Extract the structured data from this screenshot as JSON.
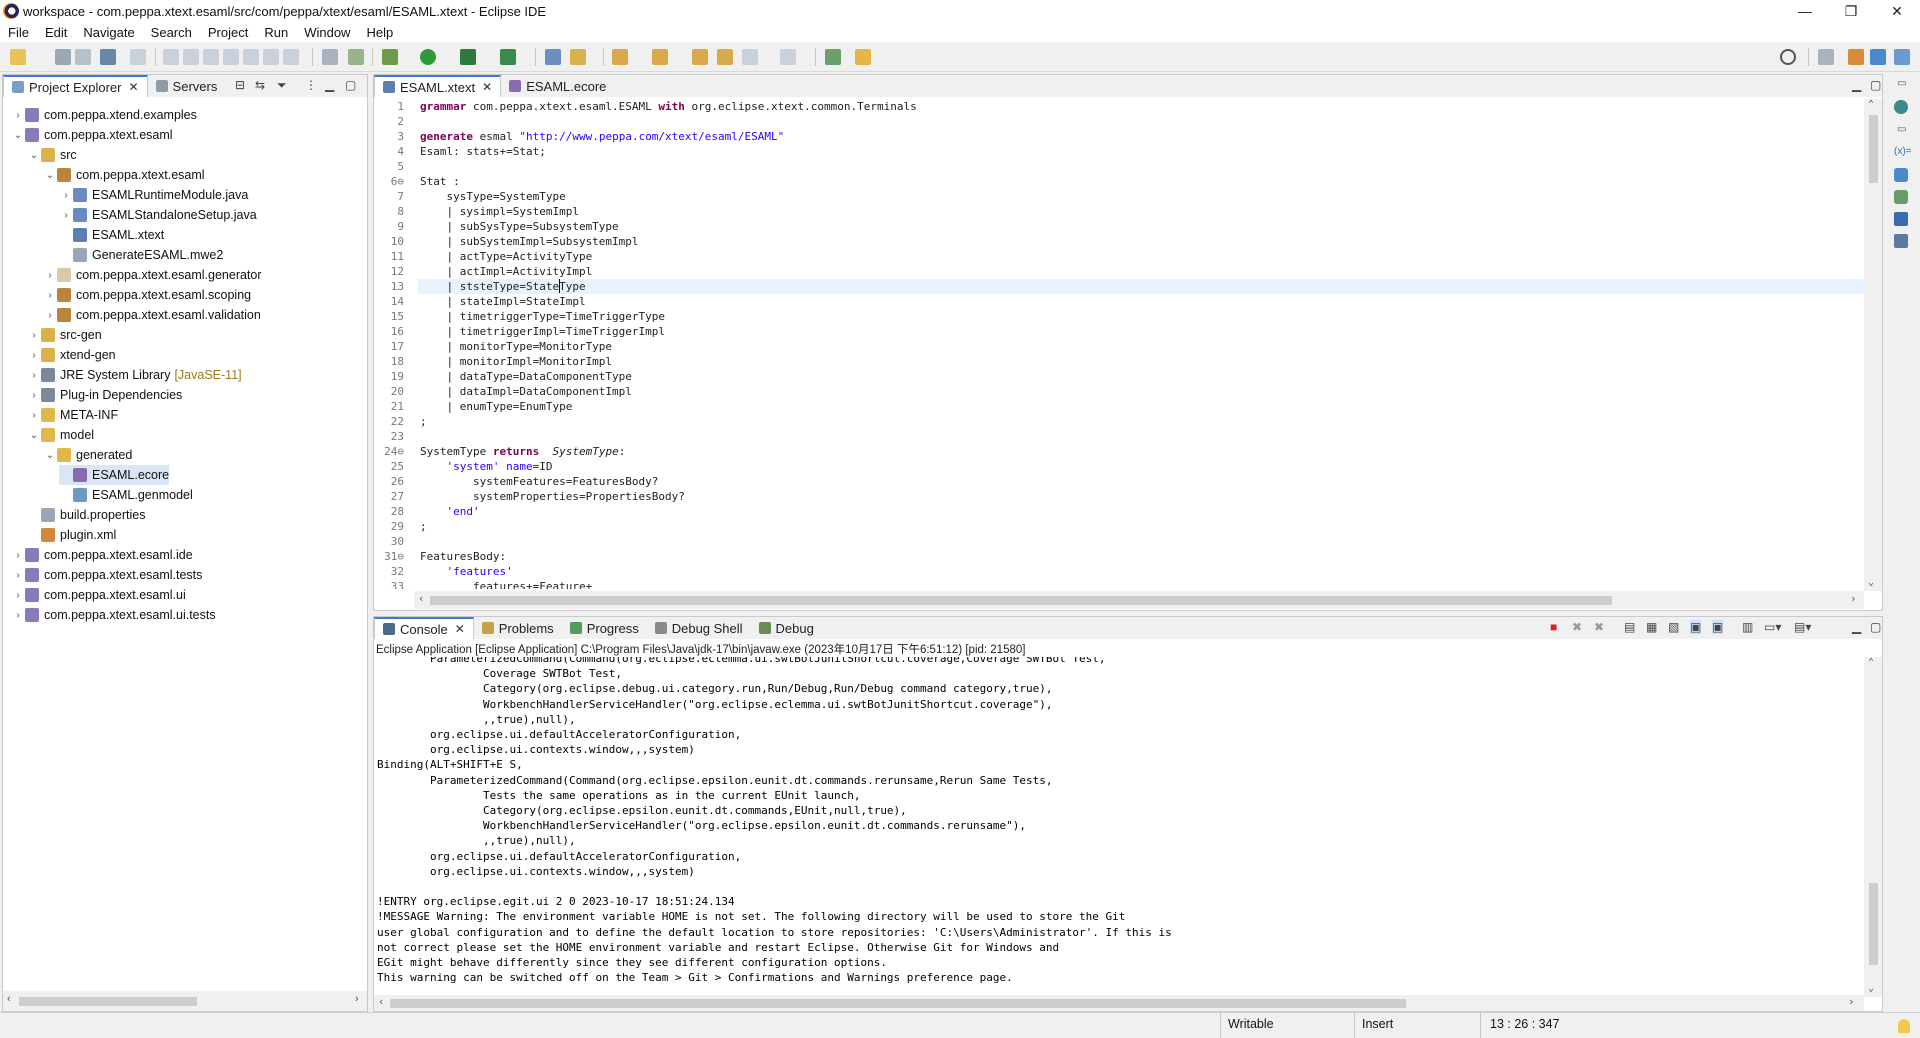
{
  "window": {
    "title": "workspace - com.peppa.xtext.esaml/src/com/peppa/xtext/esaml/ESAML.xtext - Eclipse IDE",
    "minimize": "—",
    "maximize": "❐",
    "close": "✕"
  },
  "menu": [
    "File",
    "Edit",
    "Navigate",
    "Search",
    "Project",
    "Run",
    "Window",
    "Help"
  ],
  "left_panel": {
    "tabs": [
      {
        "label": "Project Explorer",
        "close": "✕"
      },
      {
        "label": "Servers"
      }
    ],
    "tree": [
      {
        "label": "com.peppa.xtend.examples",
        "arrow": "›",
        "icon": "project-icon"
      },
      {
        "label": "com.peppa.xtext.esaml",
        "arrow": "⌄",
        "icon": "project-icon"
      },
      {
        "label": "src",
        "arrow": "⌄",
        "icon": "source-folder-icon"
      },
      {
        "label": "com.peppa.xtext.esaml",
        "arrow": "⌄",
        "icon": "package-icon"
      },
      {
        "label": "ESAMLRuntimeModule.java",
        "arrow": "›",
        "icon": "java-file-icon"
      },
      {
        "label": "ESAMLStandaloneSetup.java",
        "arrow": "›",
        "icon": "java-file-icon"
      },
      {
        "label": "ESAML.xtext",
        "arrow": "",
        "icon": "xtext-file-icon"
      },
      {
        "label": "GenerateESAML.mwe2",
        "arrow": "",
        "icon": "mwe2-file-icon"
      },
      {
        "label": "com.peppa.xtext.esaml.generator",
        "arrow": "›",
        "icon": "package-empty-icon"
      },
      {
        "label": "com.peppa.xtext.esaml.scoping",
        "arrow": "›",
        "icon": "package-icon"
      },
      {
        "label": "com.peppa.xtext.esaml.validation",
        "arrow": "›",
        "icon": "package-icon"
      },
      {
        "label": "src-gen",
        "arrow": "›",
        "icon": "source-folder-icon"
      },
      {
        "label": "xtend-gen",
        "arrow": "›",
        "icon": "source-folder-icon"
      },
      {
        "label": "JRE System Library",
        "decoration": "[JavaSE-11]",
        "arrow": "›",
        "icon": "library-icon"
      },
      {
        "label": "Plug-in Dependencies",
        "arrow": "›",
        "icon": "library-icon"
      },
      {
        "label": "META-INF",
        "arrow": "›",
        "icon": "folder-icon"
      },
      {
        "label": "model",
        "arrow": "⌄",
        "icon": "folder-icon"
      },
      {
        "label": "generated",
        "arrow": "⌄",
        "icon": "folder-icon"
      },
      {
        "label": "ESAML.ecore",
        "arrow": "",
        "icon": "ecore-file-icon"
      },
      {
        "label": "ESAML.genmodel",
        "arrow": "",
        "icon": "genmodel-file-icon"
      },
      {
        "label": "build.properties",
        "arrow": "",
        "icon": "properties-file-icon"
      },
      {
        "label": "plugin.xml",
        "arrow": "",
        "icon": "xml-file-icon"
      },
      {
        "label": "com.peppa.xtext.esaml.ide",
        "arrow": "›",
        "icon": "project-icon"
      },
      {
        "label": "com.peppa.xtext.esaml.tests",
        "arrow": "›",
        "icon": "project-icon"
      },
      {
        "label": "com.peppa.xtext.esaml.ui",
        "arrow": "›",
        "icon": "project-icon"
      },
      {
        "label": "com.peppa.xtext.esaml.ui.tests",
        "arrow": "›",
        "icon": "project-icon"
      }
    ]
  },
  "editor": {
    "tabs": [
      {
        "label": "ESAML.xtext",
        "close": "✕"
      },
      {
        "label": "ESAML.ecore"
      }
    ],
    "lines": [
      {
        "n": "1",
        "t": [
          [
            "kw",
            "grammar"
          ],
          [
            "",
            "com.peppa.xtext.esaml.ESAML "
          ],
          [
            "kw",
            "with"
          ],
          [
            "",
            "org.eclipse.xtext.common.Terminals"
          ]
        ]
      },
      {
        "n": "2",
        "t": []
      },
      {
        "n": "3",
        "t": [
          [
            "kw",
            "generate"
          ],
          [
            "",
            "esmal "
          ],
          [
            "str",
            "\"http://www.peppa.com/xtext/esaml/ESAML\""
          ]
        ]
      },
      {
        "n": "4",
        "t": [
          [
            "",
            "Esaml: stats+=Stat;"
          ]
        ]
      },
      {
        "n": "5",
        "t": []
      },
      {
        "n": "6⊖",
        "t": [
          [
            "",
            "Stat :"
          ]
        ]
      },
      {
        "n": "7",
        "t": [
          [
            "",
            "    sysType=SystemType"
          ]
        ]
      },
      {
        "n": "8",
        "t": [
          [
            "",
            "    | sysimpl=SystemImpl"
          ]
        ]
      },
      {
        "n": "9",
        "t": [
          [
            "",
            "    | subSysType=SubsystemType"
          ]
        ]
      },
      {
        "n": "10",
        "t": [
          [
            "",
            "    | subSystemImpl=SubsystemImpl"
          ]
        ]
      },
      {
        "n": "11",
        "t": [
          [
            "",
            "    | actType=ActivityType"
          ]
        ]
      },
      {
        "n": "12",
        "t": [
          [
            "",
            "    | actImpl=ActivityImpl"
          ]
        ]
      },
      {
        "n": "13",
        "t": [
          [
            "",
            "    | ststeType=StateType"
          ]
        ]
      },
      {
        "n": "14",
        "t": [
          [
            "",
            "    | stateImpl=StateImpl"
          ]
        ]
      },
      {
        "n": "15",
        "t": [
          [
            "",
            "    | timetriggerType=TimeTriggerType"
          ]
        ]
      },
      {
        "n": "16",
        "t": [
          [
            "",
            "    | timetriggerImpl=TimeTriggerImpl"
          ]
        ]
      },
      {
        "n": "17",
        "t": [
          [
            "",
            "    | monitorType=MonitorType"
          ]
        ]
      },
      {
        "n": "18",
        "t": [
          [
            "",
            "    | monitorImpl=MonitorImpl"
          ]
        ]
      },
      {
        "n": "19",
        "t": [
          [
            "",
            "    | dataType=DataComponentType"
          ]
        ]
      },
      {
        "n": "20",
        "t": [
          [
            "",
            "    | dataImpl=DataComponentImpl"
          ]
        ]
      },
      {
        "n": "21",
        "t": [
          [
            "",
            "    | enumType=EnumType"
          ]
        ]
      },
      {
        "n": "22",
        "t": [
          [
            "",
            ";"
          ]
        ]
      },
      {
        "n": "23",
        "t": []
      },
      {
        "n": "24⊖",
        "t": [
          [
            "",
            "SystemType "
          ],
          [
            "kw",
            "returns"
          ],
          [
            "it",
            " SystemType"
          ],
          [
            "",
            ":"
          ]
        ]
      },
      {
        "n": "25",
        "t": [
          [
            "",
            "    "
          ],
          [
            "str",
            "'system'"
          ],
          [
            "",
            ""
          ],
          [
            "str",
            " name"
          ],
          [
            "",
            "=ID"
          ]
        ]
      },
      {
        "n": "26",
        "t": [
          [
            "",
            "        systemFeatures=FeaturesBody?"
          ]
        ]
      },
      {
        "n": "27",
        "t": [
          [
            "",
            "        systemProperties=PropertiesBody?"
          ]
        ]
      },
      {
        "n": "28",
        "t": [
          [
            "",
            "    "
          ],
          [
            "str",
            "'end'"
          ]
        ]
      },
      {
        "n": "29",
        "t": [
          [
            "",
            ";"
          ]
        ]
      },
      {
        "n": "30",
        "t": []
      },
      {
        "n": "31⊖",
        "t": [
          [
            "",
            "FeaturesBody:"
          ]
        ]
      },
      {
        "n": "32",
        "t": [
          [
            "",
            "    "
          ],
          [
            "str",
            "'features'"
          ]
        ]
      },
      {
        "n": "33",
        "t": [
          [
            "",
            "        features+=Feature+"
          ]
        ]
      }
    ]
  },
  "bottom_panel": {
    "tabs": [
      {
        "label": "Console",
        "close": "✕"
      },
      {
        "label": "Problems"
      },
      {
        "label": "Progress"
      },
      {
        "label": "Debug Shell"
      },
      {
        "label": "Debug"
      }
    ],
    "launch_info": "Eclipse Application [Eclipse Application] C:\\Program Files\\Java\\jdk-17\\bin\\javaw.exe  (2023年10月17日 下午6:51:12) [pid: 21580]",
    "lines": [
      "        ParameterizedCommand(Command(org.eclipse.eclemma.ui.swtBotJunitShortcut.coverage,Coverage SWTBot Test,",
      "                Coverage SWTBot Test,",
      "                Category(org.eclipse.debug.ui.category.run,Run/Debug,Run/Debug command category,true),",
      "                WorkbenchHandlerServiceHandler(\"org.eclipse.eclemma.ui.swtBotJunitShortcut.coverage\"),",
      "                ,,true),null),",
      "        org.eclipse.ui.defaultAcceleratorConfiguration,",
      "        org.eclipse.ui.contexts.window,,,system)",
      "Binding(ALT+SHIFT+E S,",
      "        ParameterizedCommand(Command(org.eclipse.epsilon.eunit.dt.commands.rerunsame,Rerun Same Tests,",
      "                Tests the same operations as in the current EUnit launch,",
      "                Category(org.eclipse.epsilon.eunit.dt.commands,EUnit,null,true),",
      "                WorkbenchHandlerServiceHandler(\"org.eclipse.epsilon.eunit.dt.commands.rerunsame\"),",
      "                ,,true),null),",
      "        org.eclipse.ui.defaultAcceleratorConfiguration,",
      "        org.eclipse.ui.contexts.window,,,system)",
      "",
      "!ENTRY org.eclipse.egit.ui 2 0 2023-10-17 18:51:24.134",
      "!MESSAGE Warning: The environment variable HOME is not set. The following directory will be used to store the Git",
      "user global configuration and to define the default location to store repositories: 'C:\\Users\\Administrator'. If this is",
      "not correct please set the HOME environment variable and restart Eclipse. Otherwise Git for Windows and",
      "EGit might behave differently since they see different configuration options.",
      "This warning can be switched off on the Team > Git > Confirmations and Warnings preference page."
    ]
  },
  "status": {
    "writable": "Writable",
    "insert": "Insert",
    "position": "13 : 26 : 347"
  },
  "colors": {
    "accent": "#3e7bd6",
    "keyword": "#7f0055",
    "string": "#2a00ff",
    "selection": "#d9e6f5"
  }
}
